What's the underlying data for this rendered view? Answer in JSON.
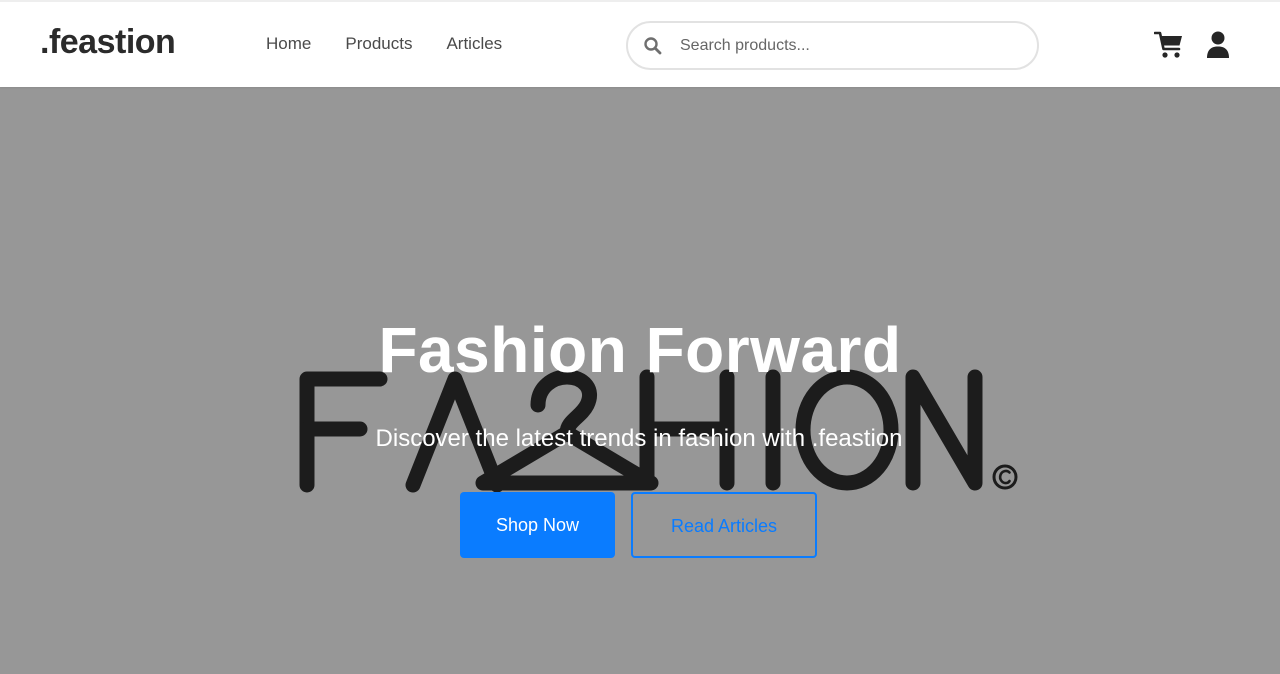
{
  "header": {
    "logo": ".feastion",
    "nav": [
      {
        "label": "Home"
      },
      {
        "label": "Products"
      },
      {
        "label": "Articles"
      }
    ],
    "search": {
      "placeholder": "Search products...",
      "value": ""
    },
    "icons": {
      "search": "search-icon",
      "cart": "cart-icon",
      "user": "user-icon"
    }
  },
  "hero": {
    "background_word": "FASHION",
    "title": "Fashion Forward",
    "subtitle": "Discover the latest trends in fashion with .feastion",
    "primary_button": "Shop Now",
    "secondary_button": "Read Articles"
  },
  "colors": {
    "accent": "#0a7cff",
    "hero_bg": "#979797",
    "logo_text": "#2b2b2b",
    "nav_text": "#4a4a4a"
  }
}
